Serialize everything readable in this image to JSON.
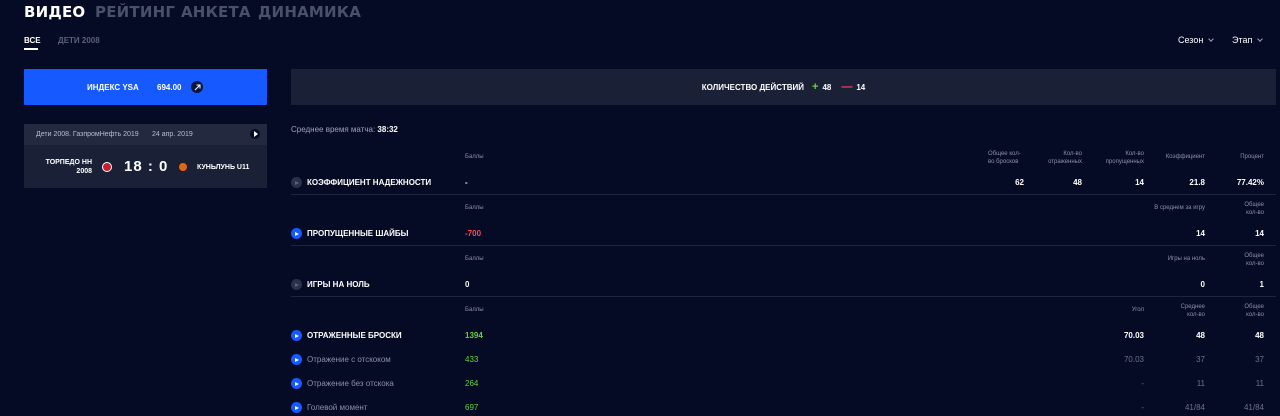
{
  "tabs": [
    "ВИДЕО",
    "РЕЙТИНГ",
    "АНКЕТА",
    "ДИНАМИКА"
  ],
  "subtabs": [
    "ВСЕ",
    "ДЕТИ 2008"
  ],
  "filters": {
    "season": "Сезон",
    "stage": "Этап"
  },
  "index": {
    "label": "ИНДЕКС YSA",
    "value": "694.00"
  },
  "match": {
    "tournament": "Дети 2008. ГазпромНефть 2019",
    "date": "24 апр. 2019",
    "home_line1": "ТОРПЕДО НН",
    "home_line2": "2008",
    "score": "18 : 0",
    "away": "КУНЬЛУНЬ U11"
  },
  "actions": {
    "label": "КОЛИЧЕСТВО ДЕЙСТВИЙ",
    "plus_sign": "+",
    "plus": "48",
    "minus_sign": "—",
    "minus": "14"
  },
  "avg_time": {
    "label": "Среднее время матча:",
    "value": "38:32"
  },
  "sections": {
    "reliability": {
      "points_label": "Баллы",
      "col1a": "Общее кол-",
      "col1b": "во бросков",
      "col2a": "Кол-во",
      "col2b": "отраженных",
      "col3a": "Кол-во",
      "col3b": "пропущенных",
      "col4": "Коэффициент",
      "col5": "Процент",
      "title": "КОЭФФИЦИЕНТ НАДЕЖНОСТИ",
      "points": "-",
      "v1": "62",
      "v2": "48",
      "v3": "14",
      "v4": "21.8",
      "v5": "77.42%"
    },
    "goals_against": {
      "points_label": "Баллы",
      "col1": "В среднем за игру",
      "col2a": "Общее",
      "col2b": "кол-во",
      "title": "ПРОПУЩЕННЫЕ ШАЙБЫ",
      "points": "-700",
      "v1": "14",
      "v2": "14"
    },
    "shutouts": {
      "points_label": "Баллы",
      "col1": "Игры на ноль",
      "col2a": "Общее",
      "col2b": "кол-во",
      "title": "ИГРЫ НА НОЛЬ",
      "points": "0",
      "v1": "0",
      "v2": "1"
    },
    "saves": {
      "points_label": "Баллы",
      "col1": "Угол",
      "col2a": "Среднее",
      "col2b": "кол-во",
      "col3a": "Общее",
      "col3b": "кол-во",
      "title": "ОТРАЖЕННЫЕ БРОСКИ",
      "points": "1394",
      "v1": "70.03",
      "v2": "48",
      "v3": "48",
      "rows": [
        {
          "label": "Отражение с отскоком",
          "points": "433",
          "v1": "70.03",
          "v2": "37",
          "v3": "37"
        },
        {
          "label": "Отражение без отскока",
          "points": "264",
          "v1": "-",
          "v2": "11",
          "v3": "11"
        },
        {
          "label": "Голевой момент",
          "points": "697",
          "v1": "-",
          "v2": "41/84",
          "v3": "41/84"
        }
      ]
    }
  }
}
